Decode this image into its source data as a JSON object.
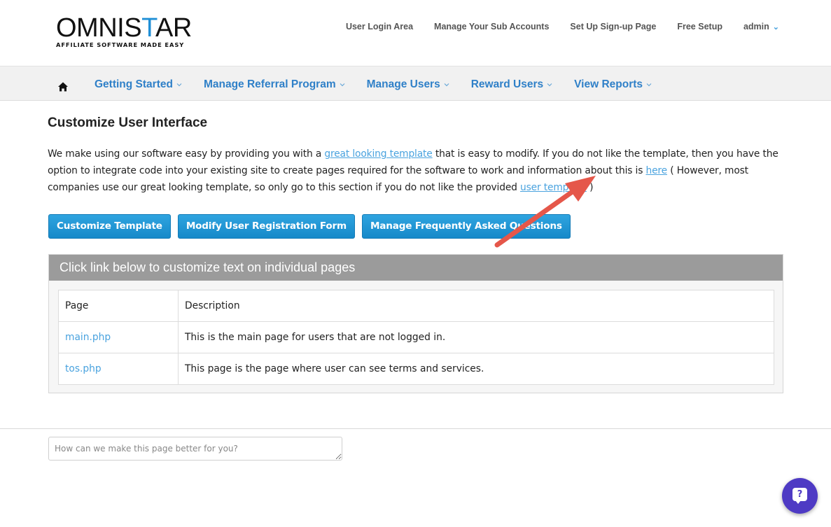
{
  "header": {
    "logo_main_prefix": "OMNIS",
    "logo_main_star": "T",
    "logo_main_suffix": "AR",
    "logo_tagline": "AFFILIATE SOFTWARE MADE EASY",
    "links": [
      {
        "label": "User Login Area"
      },
      {
        "label": "Manage Your Sub Accounts"
      },
      {
        "label": "Set Up Sign-up Page"
      },
      {
        "label": "Free Setup"
      },
      {
        "label": "admin"
      }
    ]
  },
  "nav": {
    "home_icon": "home-icon",
    "items": [
      {
        "label": "Getting Started"
      },
      {
        "label": "Manage Referral Program"
      },
      {
        "label": "Manage Users"
      },
      {
        "label": "Reward Users"
      },
      {
        "label": "View Reports"
      }
    ]
  },
  "main": {
    "title": "Customize User Interface",
    "intro": {
      "t1": "We make using our software easy by providing you with a ",
      "link1": "great looking template",
      "t2": " that is easy to modify. If you do not like the template, then you have the option to integrate code into your existing site to create pages required for the software to work and information about this is ",
      "link2": "here",
      "t3": " ( However, most companies use our great looking template, so only go to this section if you do not like the provided ",
      "link3": "user template",
      "t4": " )"
    },
    "buttons": [
      {
        "label": "Customize Template"
      },
      {
        "label": "Modify User Registration Form"
      },
      {
        "label": "Manage Frequently Asked Questions"
      }
    ],
    "panel": {
      "heading": "Click link below to customize text on individual pages",
      "columns": [
        "Page",
        "Description"
      ],
      "rows": [
        {
          "page": "main.php",
          "description": "This is the main page for users that are not logged in."
        },
        {
          "page": "tos.php",
          "description": "This page is the page where user can see terms and services."
        }
      ]
    }
  },
  "feedback": {
    "placeholder": "How can we make this page better for you?"
  },
  "help_widget": {
    "glyph": "?",
    "color": "#4e3ac4"
  },
  "annotation": {
    "arrow_color": "#e5574a"
  },
  "colors": {
    "link": "#4aa3df",
    "nav": "#2f80c8",
    "button": "#1f97d6",
    "panel_header": "#9b9b9b"
  }
}
